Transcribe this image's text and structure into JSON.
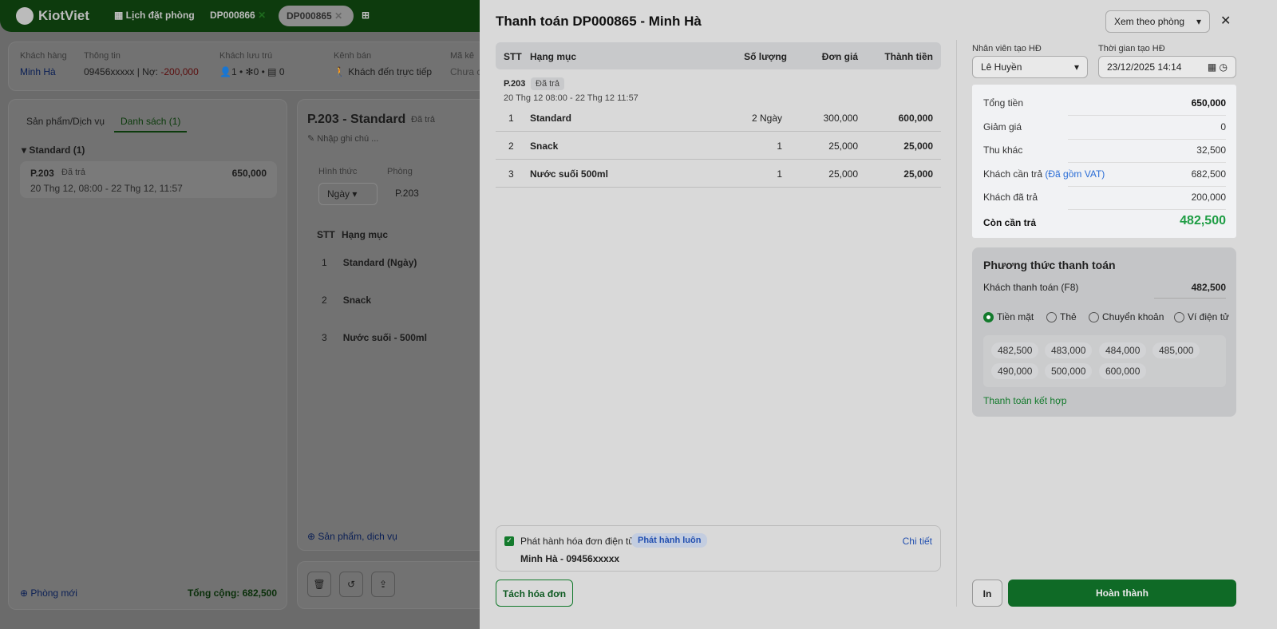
{
  "topbar": {
    "brand": "KiotViet",
    "booking_calendar": "Lịch đặt phòng",
    "tabs": [
      "DP000866",
      "DP000865"
    ]
  },
  "info": {
    "customer_label": "Khách hàng",
    "customer": "Minh Hà",
    "info_label": "Thông tin",
    "phone": "09456xxxxx",
    "debt_label": "Nợ:",
    "debt": "-200,000",
    "guests_label": "Khách lưu trú",
    "adults": "1",
    "children": "0",
    "ids": "0",
    "channel_label": "Kênh bán",
    "channel": "Khách đến trực tiếp",
    "code_label": "Mã kê",
    "code_value": "Chưa c"
  },
  "left": {
    "tab1": "Sản phẩm/Dịch vụ",
    "tab2": "Danh sách (1)",
    "group": "Standard (1)",
    "room": "P.203",
    "status": "Đã trả",
    "amount": "650,000",
    "dates": "20 Thg 12, 08:00 - 22 Thg 12, 11:57",
    "new_room": "Phòng mới",
    "total": "Tổng cộng: 682,500"
  },
  "middle": {
    "title": "P.203 - Standard",
    "status": "Đã trả",
    "note": "Nhập ghi chú ...",
    "form_label": "Hình thức",
    "form_value": "Ngày",
    "room_label": "Phòng",
    "room_value": "P.203",
    "col_stt": "STT",
    "col_item": "Hạng mục",
    "items": [
      "Standard (Ngày)",
      "Snack",
      "Nước suối - 500ml"
    ],
    "add": "Sản phẩm, dịch vụ"
  },
  "modal": {
    "title": "Thanh toán DP000865 - Minh Hà",
    "view_mode": "Xem theo phòng",
    "headers": {
      "stt": "STT",
      "item": "Hạng mục",
      "qty": "Số lượng",
      "price": "Đơn giá",
      "total": "Thành tiền"
    },
    "room": "P.203",
    "room_status": "Đã trả",
    "room_dates": "20 Thg 12 08:00 - 22 Thg 12 11:57",
    "rows": [
      {
        "stt": "1",
        "item": "Standard",
        "qty": "2 Ngày",
        "price": "300,000",
        "total": "600,000"
      },
      {
        "stt": "2",
        "item": "Snack",
        "qty": "1",
        "price": "25,000",
        "total": "25,000"
      },
      {
        "stt": "3",
        "item": "Nước suối 500ml",
        "qty": "1",
        "price": "25,000",
        "total": "25,000"
      }
    ],
    "einvoice": {
      "label": "Phát hành hóa đơn điện tử",
      "badge": "Phát hành luôn",
      "detail": "Chi tiết",
      "customer": "Minh Hà - 09456xxxxx"
    },
    "split": "Tách hóa đơn",
    "staff_label": "Nhân viên tạo HĐ",
    "staff": "Lê Huyền",
    "time_label": "Thời gian tạo HĐ",
    "time": "23/12/2025 14:14",
    "summary": [
      {
        "label": "Tổng tiền",
        "value": "650,000"
      },
      {
        "label": "Giảm giá",
        "value": "0"
      },
      {
        "label": "Thu khác",
        "value": "32,500"
      },
      {
        "label": "Khách cần trả",
        "note": "(Đã gồm VAT)",
        "value": "682,500"
      },
      {
        "label": "Khách đã trả",
        "value": "200,000"
      },
      {
        "label": "Còn cần trả",
        "value": "482,500"
      }
    ],
    "payment": {
      "title": "Phương thức thanh toán",
      "pay_label": "Khách thanh toán (F8)",
      "pay_value": "482,500",
      "methods": [
        "Tiền mặt",
        "Thẻ",
        "Chuyển khoản",
        "Ví điện tử"
      ],
      "chips": [
        "482,500",
        "483,000",
        "484,000",
        "485,000",
        "490,000",
        "500,000",
        "600,000"
      ],
      "combined": "Thanh toán kết hợp"
    },
    "print": "In",
    "done": "Hoàn thành"
  }
}
